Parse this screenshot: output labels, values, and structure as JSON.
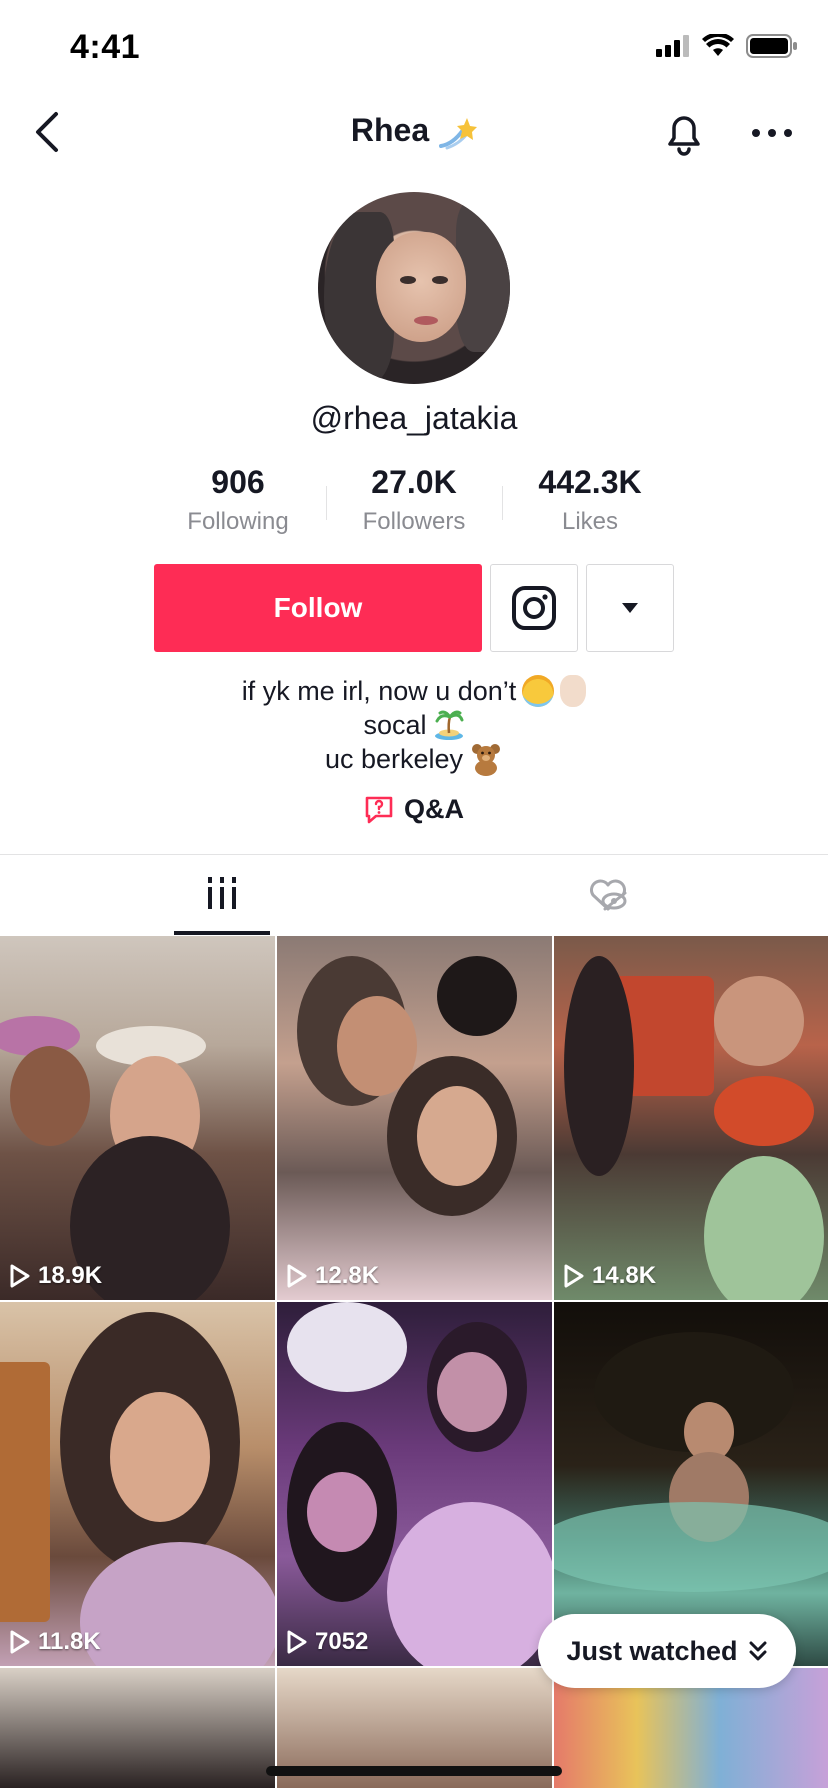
{
  "status_bar": {
    "time": "4:41"
  },
  "nav": {
    "title": "Rhea",
    "title_icon": "shooting-star-icon",
    "back_icon": "chevron-left-icon",
    "bell_icon": "bell-icon",
    "more_icon": "ellipsis-icon"
  },
  "profile": {
    "username": "@rhea_jatakia",
    "stats": [
      {
        "value": "906",
        "label": "Following"
      },
      {
        "value": "27.0K",
        "label": "Followers"
      },
      {
        "value": "442.3K",
        "label": "Likes"
      }
    ],
    "follow_label": "Follow",
    "bio": {
      "line1": "if yk me irl, now u don’t",
      "line2": "socal",
      "line3": "uc berkeley"
    },
    "qa_label": "Q&A"
  },
  "tabs": {
    "videos_icon": "grid-icon",
    "liked_icon": "liked-hidden-icon"
  },
  "videos": [
    {
      "views": "18.9K"
    },
    {
      "views": "12.8K"
    },
    {
      "views": "14.8K"
    },
    {
      "views": "11.8K"
    },
    {
      "views": "7052"
    },
    {
      "views": ""
    }
  ],
  "just_watched_label": "Just watched",
  "colors": {
    "accent": "#fe2c55",
    "text": "#161823",
    "muted": "#8a8b91"
  }
}
